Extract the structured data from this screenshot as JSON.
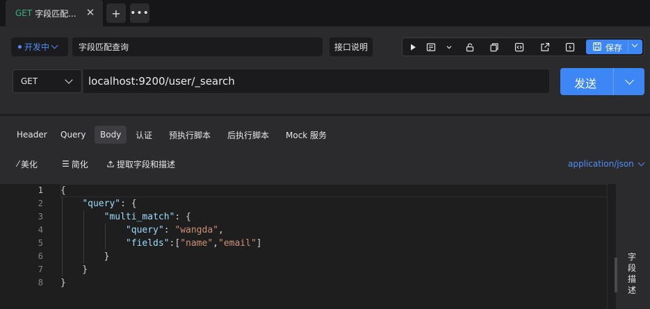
{
  "tab": {
    "method": "GET",
    "title": "字段匹配...",
    "close_icon": "close-icon"
  },
  "tabstrip": {
    "add_icon": "plus-icon",
    "more_icon": "more-horizontal-icon"
  },
  "request": {
    "environment": "开发中",
    "name": "字段匹配查询",
    "desc_button": "接口说明",
    "method": "GET",
    "url": "localhost:9200/user/_search",
    "send_label": "发送",
    "save_label": "保存"
  },
  "toolbar_icons": [
    "play-icon",
    "doc-icon",
    "chevron-down-icon",
    "lock-icon",
    "copy-icon",
    "code-icon",
    "share-icon",
    "flash-icon",
    "save-icon"
  ],
  "subtabs": [
    "Header",
    "Query",
    "Body",
    "认证",
    "预执行脚本",
    "后执行脚本",
    "Mock 服务"
  ],
  "active_subtab": "Body",
  "body_tools": {
    "beautify": "美化",
    "simplify": "简化",
    "extract": "提取字段和描述"
  },
  "content_type": "application/json",
  "editor": {
    "line_numbers": [
      "1",
      "2",
      "3",
      "4",
      "5",
      "6",
      "7",
      "8"
    ],
    "lines": [
      "{",
      "    \"query\": {",
      "        \"multi_match\": {",
      "            \"query\": \"wangda\",",
      "            \"fields\":[\"name\",\"email\"]",
      "        }",
      "    }",
      "}"
    ]
  },
  "side_panel": {
    "label": "字段描述"
  },
  "colors": {
    "accent": "#3d86f5",
    "method_green": "#36b37e",
    "json_key": "#9cdcfe",
    "json_string": "#ce9178"
  }
}
